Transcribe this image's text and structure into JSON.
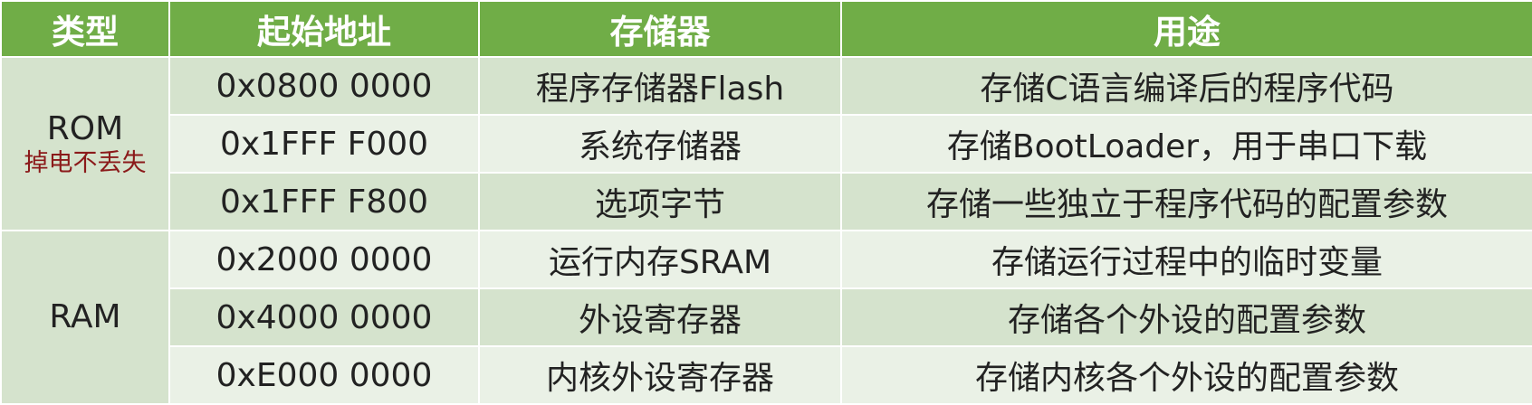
{
  "headers": {
    "type": "类型",
    "start_address": "起始地址",
    "memory": "存储器",
    "usage": "用途"
  },
  "groups": [
    {
      "type": "ROM",
      "note": "掉电不丢失",
      "rows": [
        {
          "address": "0x0800 0000",
          "memory": "程序存储器Flash",
          "usage": "存储C语言编译后的程序代码"
        },
        {
          "address": "0x1FFF F000",
          "memory": "系统存储器",
          "usage": "存储BootLoader，用于串口下载"
        },
        {
          "address": "0x1FFF F800",
          "memory": "选项字节",
          "usage": "存储一些独立于程序代码的配置参数"
        }
      ]
    },
    {
      "type": "RAM",
      "note": "",
      "rows": [
        {
          "address": "0x2000 0000",
          "memory": "运行内存SRAM",
          "usage": "存储运行过程中的临时变量"
        },
        {
          "address": "0x4000 0000",
          "memory": "外设寄存器",
          "usage": "存储各个外设的配置参数"
        },
        {
          "address": "0xE000 0000",
          "memory": "内核外设寄存器",
          "usage": "存储内核各个外设的配置参数"
        }
      ]
    }
  ],
  "colors": {
    "header_bg": "#70ad47",
    "header_text": "#ffffff",
    "row_dark": "#d5e3cd",
    "row_light": "#eaf1e6",
    "note_text": "#8b1a1a"
  }
}
